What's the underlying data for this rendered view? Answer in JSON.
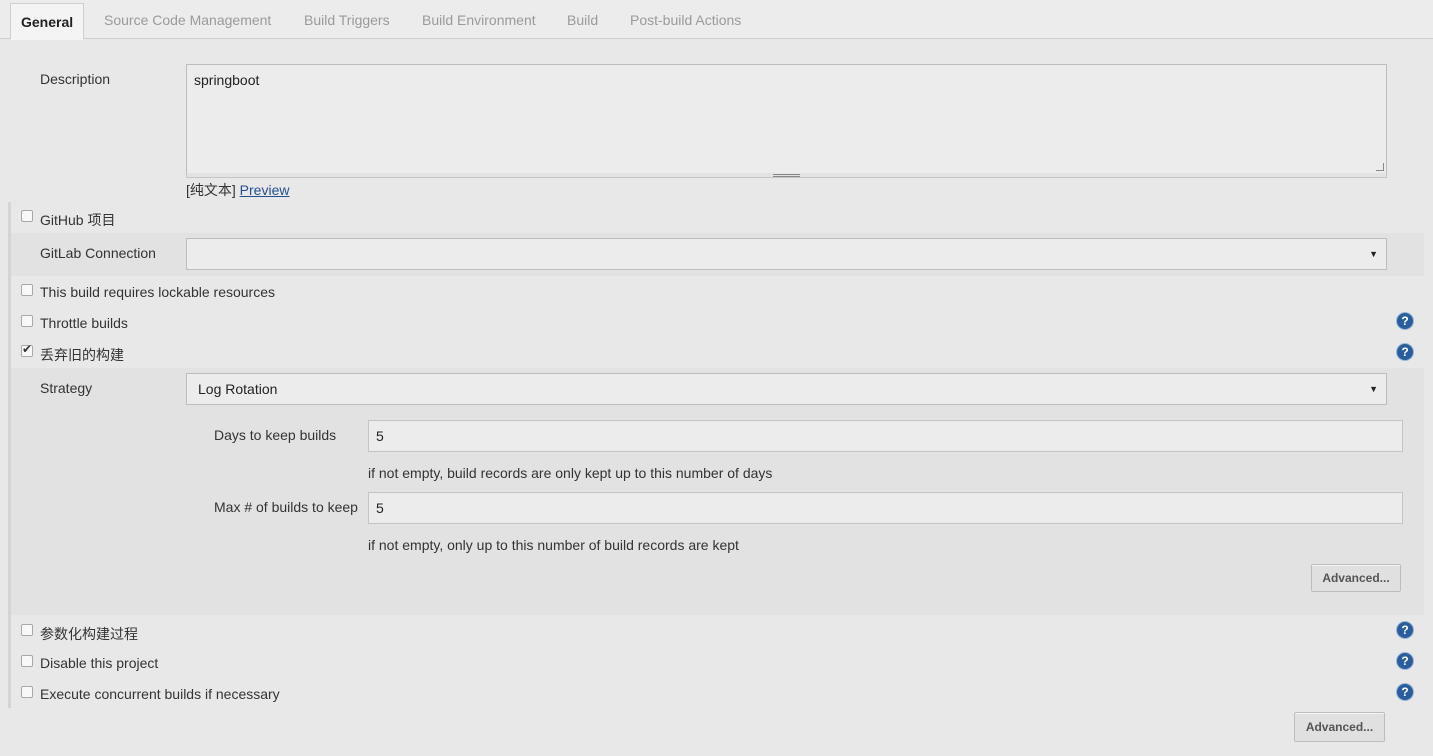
{
  "tabs": [
    {
      "label": "General",
      "active": true
    },
    {
      "label": "Source Code Management"
    },
    {
      "label": "Build Triggers"
    },
    {
      "label": "Build Environment"
    },
    {
      "label": "Build"
    },
    {
      "label": "Post-build Actions"
    }
  ],
  "description": {
    "label": "Description",
    "value": "springboot",
    "plain_text": "[纯文本]",
    "preview": "Preview"
  },
  "github_project": {
    "label": "GitHub 项目",
    "checked": false
  },
  "gitlab_connection": {
    "label": "GitLab Connection",
    "value": ""
  },
  "lockable_resources": {
    "label": "This build requires lockable resources",
    "checked": false
  },
  "throttle_builds": {
    "label": "Throttle builds",
    "checked": false
  },
  "discard_old_builds": {
    "label": "丢弃旧的构建",
    "checked": true
  },
  "strategy": {
    "label": "Strategy",
    "value": "Log Rotation",
    "days_label": "Days to keep builds",
    "days_value": "5",
    "days_hint": "if not empty, build records are only kept up to this number of days",
    "max_label": "Max # of builds to keep",
    "max_value": "5",
    "max_hint": "if not empty, only up to this number of build records are kept",
    "advanced": "Advanced..."
  },
  "parameterized": {
    "label": "参数化构建过程",
    "checked": false
  },
  "disable_project": {
    "label": "Disable this project",
    "checked": false
  },
  "concurrent_builds": {
    "label": "Execute concurrent builds if necessary",
    "checked": false
  },
  "advanced_bottom": "Advanced...",
  "help_glyph": "?",
  "select_arrow": "▼",
  "colors": {
    "link": "#24508f",
    "help_icon": "#2a5d9c"
  }
}
